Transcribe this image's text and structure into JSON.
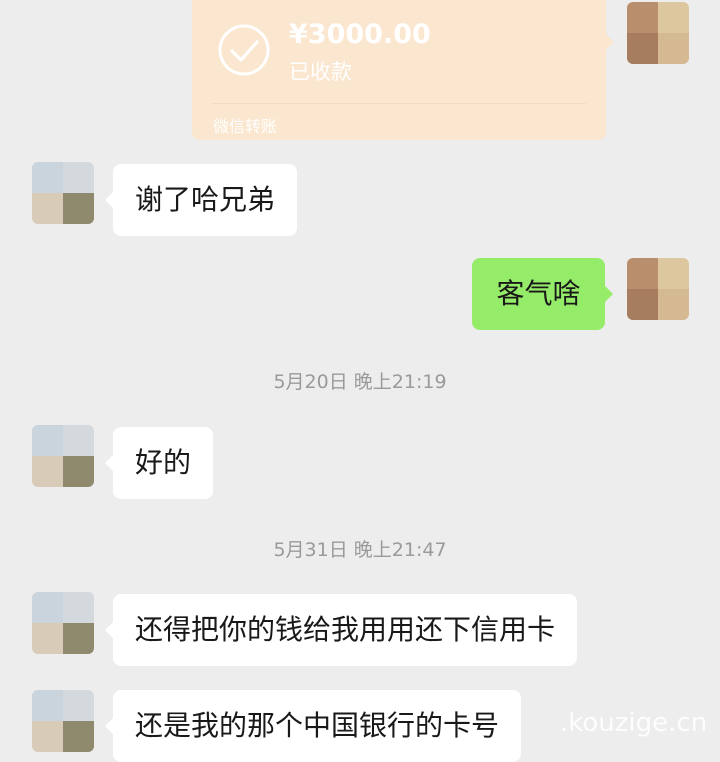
{
  "transfer": {
    "amount": "¥3000.00",
    "status": "已收款",
    "label": "微信转账"
  },
  "messages": [
    {
      "side": "left",
      "text": "谢了哈兄弟"
    },
    {
      "side": "right",
      "text": "客气啥"
    },
    {
      "side": "left",
      "text": "好的"
    },
    {
      "side": "left",
      "text": "还得把你的钱给我用用还下信用卡"
    },
    {
      "side": "left",
      "text": "还是我的那个中国银行的卡号"
    }
  ],
  "timestamps": [
    "5月20日 晚上21:19",
    "5月31日 晚上21:47"
  ],
  "watermark": ".kouzige.cn",
  "colors": {
    "background": "#ededed",
    "sent_bubble": "#95ec69",
    "received_bubble": "#ffffff",
    "transfer_card": "#fbe6cf"
  }
}
